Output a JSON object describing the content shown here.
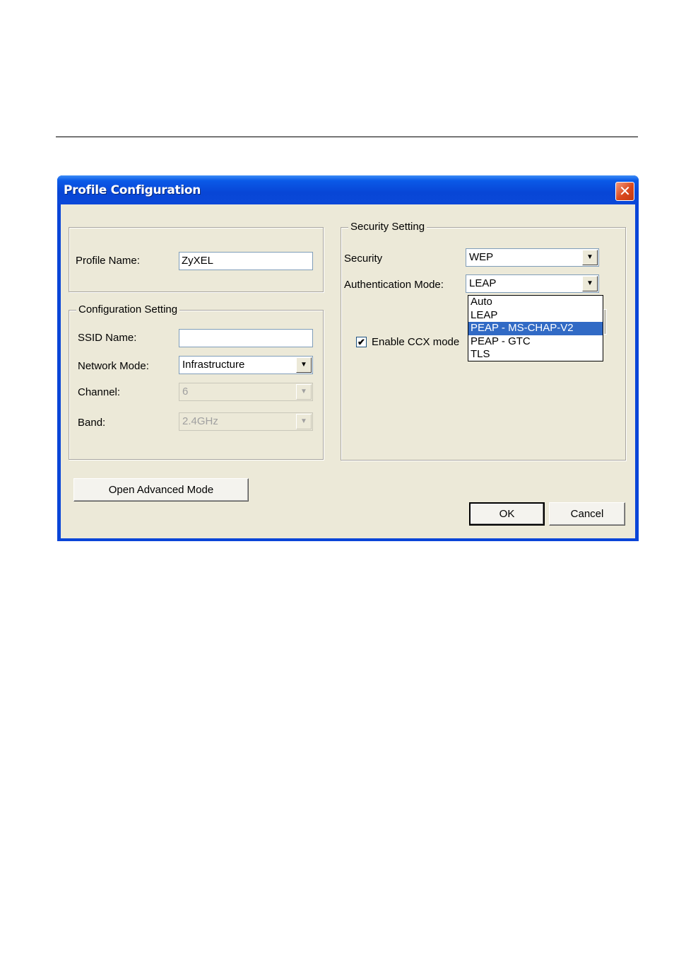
{
  "window": {
    "title": "Profile Configuration",
    "close_glyph": "✕"
  },
  "profile": {
    "label": "Profile Name:",
    "value": "ZyXEL"
  },
  "config": {
    "legend": "Configuration Setting",
    "ssid_label": "SSID Name:",
    "ssid_value": "",
    "network_mode_label": "Network Mode:",
    "network_mode_value": "Infrastructure",
    "channel_label": "Channel:",
    "channel_value": "6",
    "band_label": "Band:",
    "band_value": "2.4GHz"
  },
  "security": {
    "legend": "Security Setting",
    "security_label": "Security",
    "security_value": "WEP",
    "auth_label": "Authentication Mode:",
    "auth_value": "LEAP",
    "auth_options": [
      "Auto",
      "LEAP",
      "PEAP - MS-CHAP-V2",
      "PEAP - GTC",
      "TLS"
    ],
    "auth_highlighted": "PEAP - MS-CHAP-V2",
    "ccx_label": "Enable CCX mode",
    "ccx_checked": true
  },
  "buttons": {
    "advanced": "Open Advanced Mode",
    "ok": "OK",
    "cancel": "Cancel"
  },
  "icons": {
    "dropdown_arrow": "▼",
    "check": "✔"
  },
  "colors": {
    "title_bar": "#0a45d8",
    "dialog_bg": "#ece9d8",
    "selection": "#316ac5",
    "close_button": "#d9471c"
  }
}
